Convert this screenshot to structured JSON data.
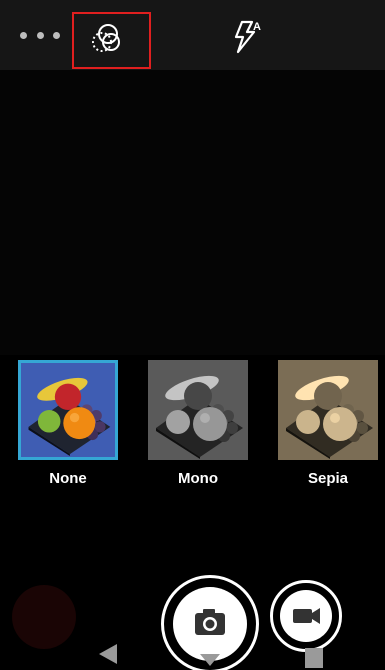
{
  "top_bar": {
    "overflow_icon": "more-horizontal-icon",
    "filter_icon": "filters-icon",
    "flash_icon": "flash-auto-icon",
    "highlight_color": "#e01f1f"
  },
  "filters": {
    "selected_color": "#35a7d4",
    "items": [
      {
        "label": "None",
        "selected": true
      },
      {
        "label": "Mono",
        "selected": false
      },
      {
        "label": "Sepia",
        "selected": false
      }
    ]
  },
  "controls": {
    "gallery_icon": "last-photo-thumbnail",
    "shutter_icon": "camera-icon",
    "video_icon": "video-camera-icon"
  },
  "nav_bar": {
    "back_icon": "back-triangle-icon",
    "home_icon": "home-icon",
    "recent_icon": "recent-apps-icon"
  }
}
